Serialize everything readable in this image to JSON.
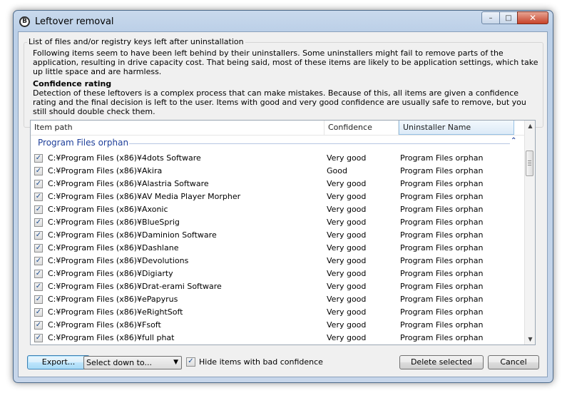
{
  "window": {
    "title": "Leftover removal",
    "app_icon_letter": "B",
    "controls": {
      "minimize": "–",
      "maximize": "□",
      "close": "✕"
    }
  },
  "intro": {
    "group_label": "List of files and/or registry keys left after uninstallation",
    "description": "Following items seem to have been left behind by their uninstallers. Some uninstallers might fail to remove parts of the application, resulting in drive capacity cost. That being said, most of these items are likely to be application settings, which take up little space and are harmless.",
    "confidence_title": "Confidence rating",
    "confidence_text": "Detection of these leftovers is a complex process that can make mistakes. Because of this, all items are given a confidence rating and the final decision is left to the user. Items with good and very good confidence are usually safe to remove, but you still should double check them."
  },
  "list": {
    "columns": [
      "Item path",
      "Confidence",
      "Uninstaller Name"
    ],
    "group": {
      "name": "Program Files orphan",
      "chevron": "⌃"
    },
    "rows": [
      {
        "path": "C:¥Program Files (x86)¥4dots Software",
        "confidence": "Very good",
        "uninstaller": "Program Files orphan",
        "checked": true
      },
      {
        "path": "C:¥Program Files (x86)¥Akira",
        "confidence": "Good",
        "uninstaller": "Program Files orphan",
        "checked": true
      },
      {
        "path": "C:¥Program Files (x86)¥Alastria Software",
        "confidence": "Very good",
        "uninstaller": "Program Files orphan",
        "checked": true
      },
      {
        "path": "C:¥Program Files (x86)¥AV Media Player Morpher",
        "confidence": "Very good",
        "uninstaller": "Program Files orphan",
        "checked": true
      },
      {
        "path": "C:¥Program Files (x86)¥Axonic",
        "confidence": "Very good",
        "uninstaller": "Program Files orphan",
        "checked": true
      },
      {
        "path": "C:¥Program Files (x86)¥BlueSprig",
        "confidence": "Very good",
        "uninstaller": "Program Files orphan",
        "checked": true
      },
      {
        "path": "C:¥Program Files (x86)¥Daminion Software",
        "confidence": "Very good",
        "uninstaller": "Program Files orphan",
        "checked": true
      },
      {
        "path": "C:¥Program Files (x86)¥Dashlane",
        "confidence": "Very good",
        "uninstaller": "Program Files orphan",
        "checked": true
      },
      {
        "path": "C:¥Program Files (x86)¥Devolutions",
        "confidence": "Very good",
        "uninstaller": "Program Files orphan",
        "checked": true
      },
      {
        "path": "C:¥Program Files (x86)¥Digiarty",
        "confidence": "Very good",
        "uninstaller": "Program Files orphan",
        "checked": true
      },
      {
        "path": "C:¥Program Files (x86)¥Drat-erami Software",
        "confidence": "Very good",
        "uninstaller": "Program Files orphan",
        "checked": true
      },
      {
        "path": "C:¥Program Files (x86)¥ePapyrus",
        "confidence": "Very good",
        "uninstaller": "Program Files orphan",
        "checked": true
      },
      {
        "path": "C:¥Program Files (x86)¥eRightSoft",
        "confidence": "Very good",
        "uninstaller": "Program Files orphan",
        "checked": true
      },
      {
        "path": "C:¥Program Files (x86)¥Fsoft",
        "confidence": "Very good",
        "uninstaller": "Program Files orphan",
        "checked": true
      },
      {
        "path": "C:¥Program Files (x86)¥full phat",
        "confidence": "Very good",
        "uninstaller": "Program Files orphan",
        "checked": true
      }
    ],
    "check_glyph": "✓",
    "scroll_up": "▲",
    "scroll_down": "▼",
    "sort_glyph": "^"
  },
  "footer": {
    "export_label": "Export...",
    "select_down_value": "Select down to...",
    "select_arrow": "▼",
    "hide_checkbox_checked": true,
    "hide_label": "Hide items with bad confidence",
    "delete_label": "Delete selected",
    "cancel_label": "Cancel"
  }
}
